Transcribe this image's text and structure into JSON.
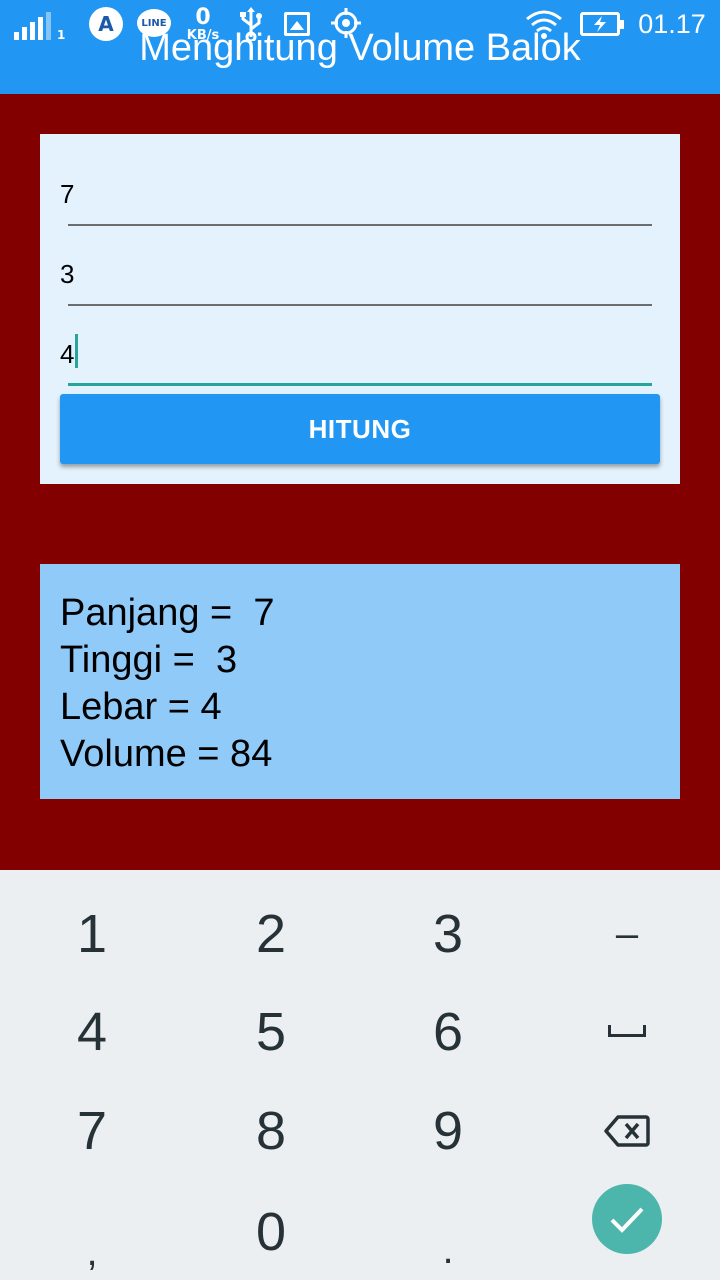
{
  "app": {
    "title": "Menghitung Volume Balok"
  },
  "statusbar": {
    "signal_sub": "1",
    "a_icon_label": "A",
    "line_icon_label": "LINE",
    "speed_value": "0",
    "speed_unit": "KB/s",
    "time": "01.17",
    "icons": [
      "signal-icon",
      "app-a-icon",
      "line-app-icon",
      "data-speed-indicator",
      "usb-icon",
      "image-icon",
      "gps-icon",
      "wifi-icon",
      "battery-charging-icon"
    ]
  },
  "form": {
    "panjang_value": "7",
    "tinggi_value": "3",
    "lebar_value": "4",
    "button_label": "HITUNG"
  },
  "result": {
    "panjang": "Panjang =  7",
    "tinggi": "Tinggi =  3",
    "lebar": "Lebar = 4",
    "volume": "Volume = 84"
  },
  "keyboard": {
    "k1": "1",
    "k2": "2",
    "k3": "3",
    "minus": "–",
    "k4": "4",
    "k5": "5",
    "k6": "6",
    "k7": "7",
    "k8": "8",
    "k9": "9",
    "comma": ",",
    "k0": "0",
    "dot": ".",
    "icons": [
      "space-icon",
      "backspace-icon",
      "done-check-icon"
    ]
  },
  "colors": {
    "background": "#830000",
    "appbar": "#2196f3",
    "form_card": "#e3f2fd",
    "result_box": "#90caf9",
    "accent": "#26a69a",
    "keyboard": "#eceff1",
    "done_key": "#4db6ac"
  }
}
